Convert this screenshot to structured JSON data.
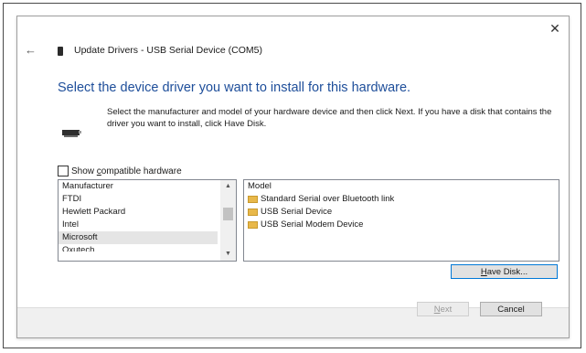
{
  "dialog": {
    "close_glyph": "✕",
    "back_glyph": "←",
    "title": "Update Drivers - USB Serial Device (COM5)",
    "heading": "Select the device driver you want to install for this hardware.",
    "description": "Select the manufacturer and model of your hardware device and then click Next. If you have a disk that contains the driver you want to install, click Have Disk."
  },
  "compatible": {
    "label_pre": "Show ",
    "label_accel": "c",
    "label_post": "ompatible hardware",
    "checked": false
  },
  "manufacturer_list": {
    "header": "Manufacturer",
    "items": [
      "FTDI",
      "Hewlett Packard",
      "Intel",
      "Microsoft",
      "Oxutech"
    ],
    "selected": "Microsoft"
  },
  "model_list": {
    "header": "Model",
    "items": [
      "Standard Serial over Bluetooth link",
      "USB Serial Device",
      "USB Serial Modem Device"
    ]
  },
  "buttons": {
    "have_disk_accel": "H",
    "have_disk_rest": "ave Disk...",
    "next_accel": "N",
    "next_rest": "ext",
    "cancel": "Cancel"
  },
  "scroll": {
    "up_glyph": "▲",
    "down_glyph": "▼"
  },
  "colors": {
    "heading": "#1e4e9a",
    "selection": "#e5e5e5",
    "folder": "#e8b84a"
  }
}
